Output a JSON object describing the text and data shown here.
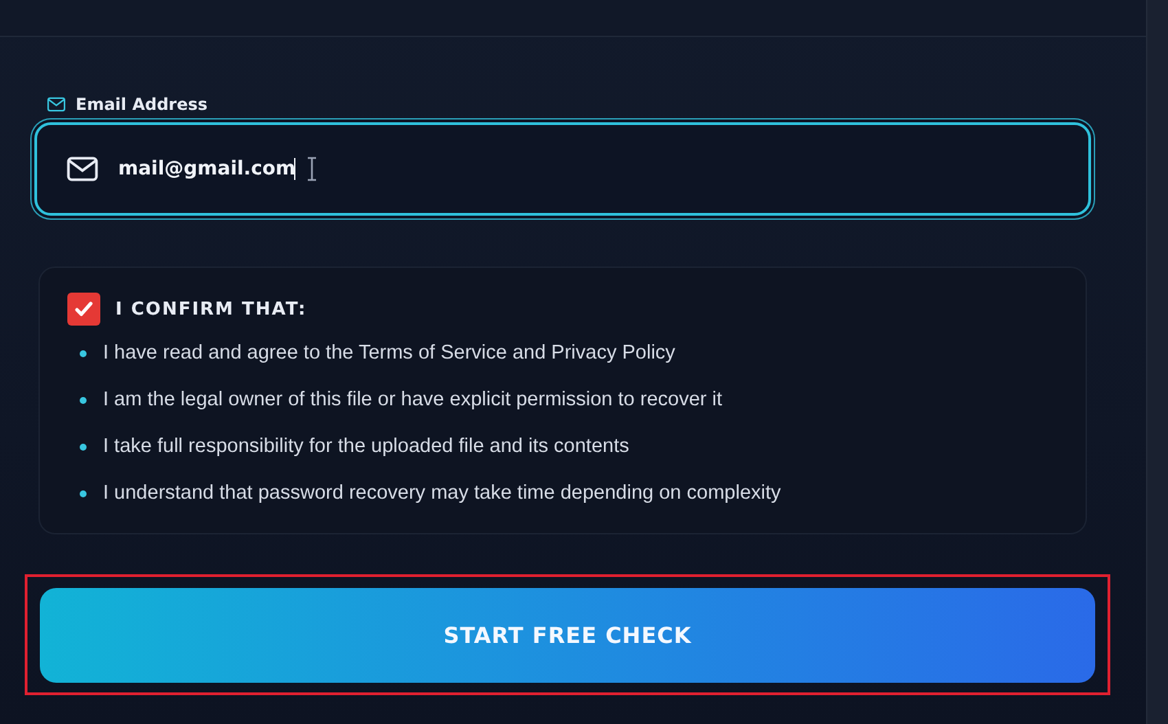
{
  "email": {
    "label": "Email Address",
    "value": "mail@gmail.com",
    "focused": true
  },
  "confirm": {
    "checked": true,
    "title": "I CONFIRM THAT:",
    "items": [
      "I have read and agree to the Terms of Service and Privacy Policy",
      "I am the legal owner of this file or have explicit permission to recover it",
      "I take full responsibility for the uploaded file and its contents",
      "I understand that password recovery may take time depending on complexity"
    ]
  },
  "submit": {
    "label": "START FREE CHECK",
    "highlighted": true
  }
}
